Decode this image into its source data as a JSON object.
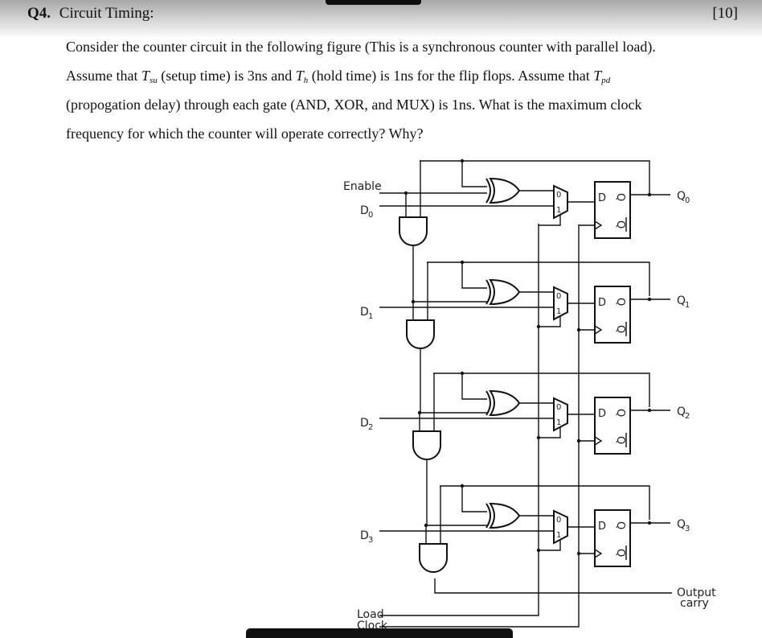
{
  "question": {
    "number": "Q4.",
    "title": "Circuit Timing:",
    "marks": "[10]",
    "line1": "Consider the counter circuit in the following figure (This is a synchronous counter with parallel load).",
    "line2_pre": "Assume that ",
    "tsu_symbol": "T",
    "tsu_sub": "su",
    "line2_mid1": " (setup time) is 3ns and ",
    "th_symbol": "T",
    "th_sub": "h",
    "line2_mid2": " (hold time) is 1ns for the flip flops. Assume that ",
    "tpd_symbol": "T",
    "tpd_sub": "pd",
    "line3": "(propogation delay) through each gate (AND, XOR, and MUX) is 1ns. What is the maximum clock",
    "line4": "frequency for which the counter will operate correctly? Why?"
  },
  "figure": {
    "inputs": {
      "enable": "Enable",
      "d_labels": [
        "D",
        "D",
        "D",
        "D"
      ],
      "d_subs": [
        "0",
        "1",
        "2",
        "3"
      ],
      "load": "Load",
      "clock": "Clock"
    },
    "outputs": {
      "q_labels": [
        "Q",
        "Q",
        "Q",
        "Q"
      ],
      "q_subs": [
        "0",
        "1",
        "2",
        "3"
      ],
      "carry_line1": "Output",
      "carry_line2": "carry"
    },
    "flipflop": {
      "d": "D",
      "q": "Q",
      "qbar": "Q"
    },
    "mux": {
      "in0": "0",
      "in1": "1"
    },
    "stages": 4
  }
}
